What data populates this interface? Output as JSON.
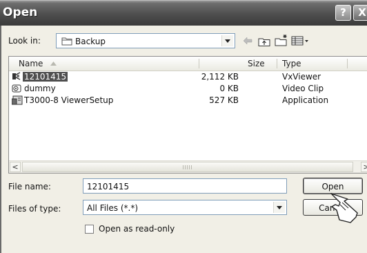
{
  "window": {
    "title": "Open",
    "help_glyph": "?",
    "close_glyph": "X"
  },
  "look_in": {
    "label": "Look in:",
    "value": "Backup",
    "folder_icon": "folder-icon"
  },
  "toolbar": {
    "icons": [
      "back-arrow-icon",
      "up-folder-icon",
      "new-folder-icon",
      "view-menu-icon"
    ]
  },
  "file_list": {
    "columns": {
      "name": "Name",
      "size": "Size",
      "type": "Type"
    },
    "rows": [
      {
        "name": "12101415",
        "size": "2,112 KB",
        "type": "VxViewer",
        "icon": "viewer-file-icon",
        "selected": true
      },
      {
        "name": "dummy",
        "size": "0 KB",
        "type": "Video Clip",
        "icon": "video-clip-icon",
        "selected": false
      },
      {
        "name": "T3000-8 ViewerSetup",
        "size": "527 KB",
        "type": "Application",
        "icon": "setup-app-icon",
        "selected": false
      }
    ],
    "scroll_left": "<",
    "scroll_right": ">"
  },
  "file_name": {
    "label": "File name:",
    "value": "12101415"
  },
  "files_of_type": {
    "label": "Files of type:",
    "value": "All Files (*.*)"
  },
  "buttons": {
    "open": "Open",
    "cancel": "Cancel"
  },
  "read_only": {
    "label": "Open as read-only",
    "checked": false
  }
}
